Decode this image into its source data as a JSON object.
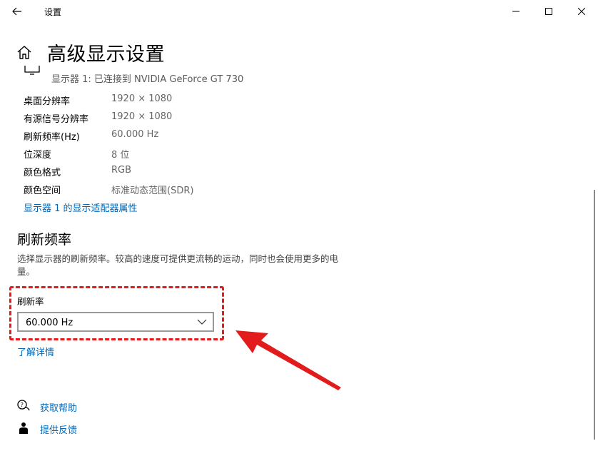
{
  "titlebar": {
    "title": "设置"
  },
  "page": {
    "title": "高级显示设置"
  },
  "display": {
    "monitor_line": "显示器 1: 已连接到 NVIDIA GeForce GT 730",
    "info": [
      {
        "label": "桌面分辨率",
        "value": "1920 × 1080"
      },
      {
        "label": "有源信号分辨率",
        "value": "1920 × 1080"
      },
      {
        "label": "刷新频率(Hz)",
        "value": "60.000 Hz"
      },
      {
        "label": "位深度",
        "value": "8 位"
      },
      {
        "label": "颜色格式",
        "value": "RGB"
      },
      {
        "label": "颜色空间",
        "value": "标准动态范围(SDR)"
      }
    ],
    "adapter_link": "显示器 1 的显示适配器属性"
  },
  "refresh": {
    "section_title": "刷新频率",
    "description": "选择显示器的刷新频率。较高的速度可提供更流畅的运动，同时也会使用更多的电量。",
    "rate_label": "刷新率",
    "selected_rate": "60.000 Hz",
    "learn_more": "了解详情"
  },
  "footer": {
    "help": "获取帮助",
    "feedback": "提供反馈"
  },
  "colors": {
    "link": "#0067b8",
    "annotation": "#e21c1c"
  },
  "icons": [
    "back-arrow-icon",
    "minimize-icon",
    "maximize-icon",
    "close-icon",
    "home-icon",
    "monitor-icon",
    "chevron-down-icon",
    "help-icon",
    "feedback-icon"
  ]
}
